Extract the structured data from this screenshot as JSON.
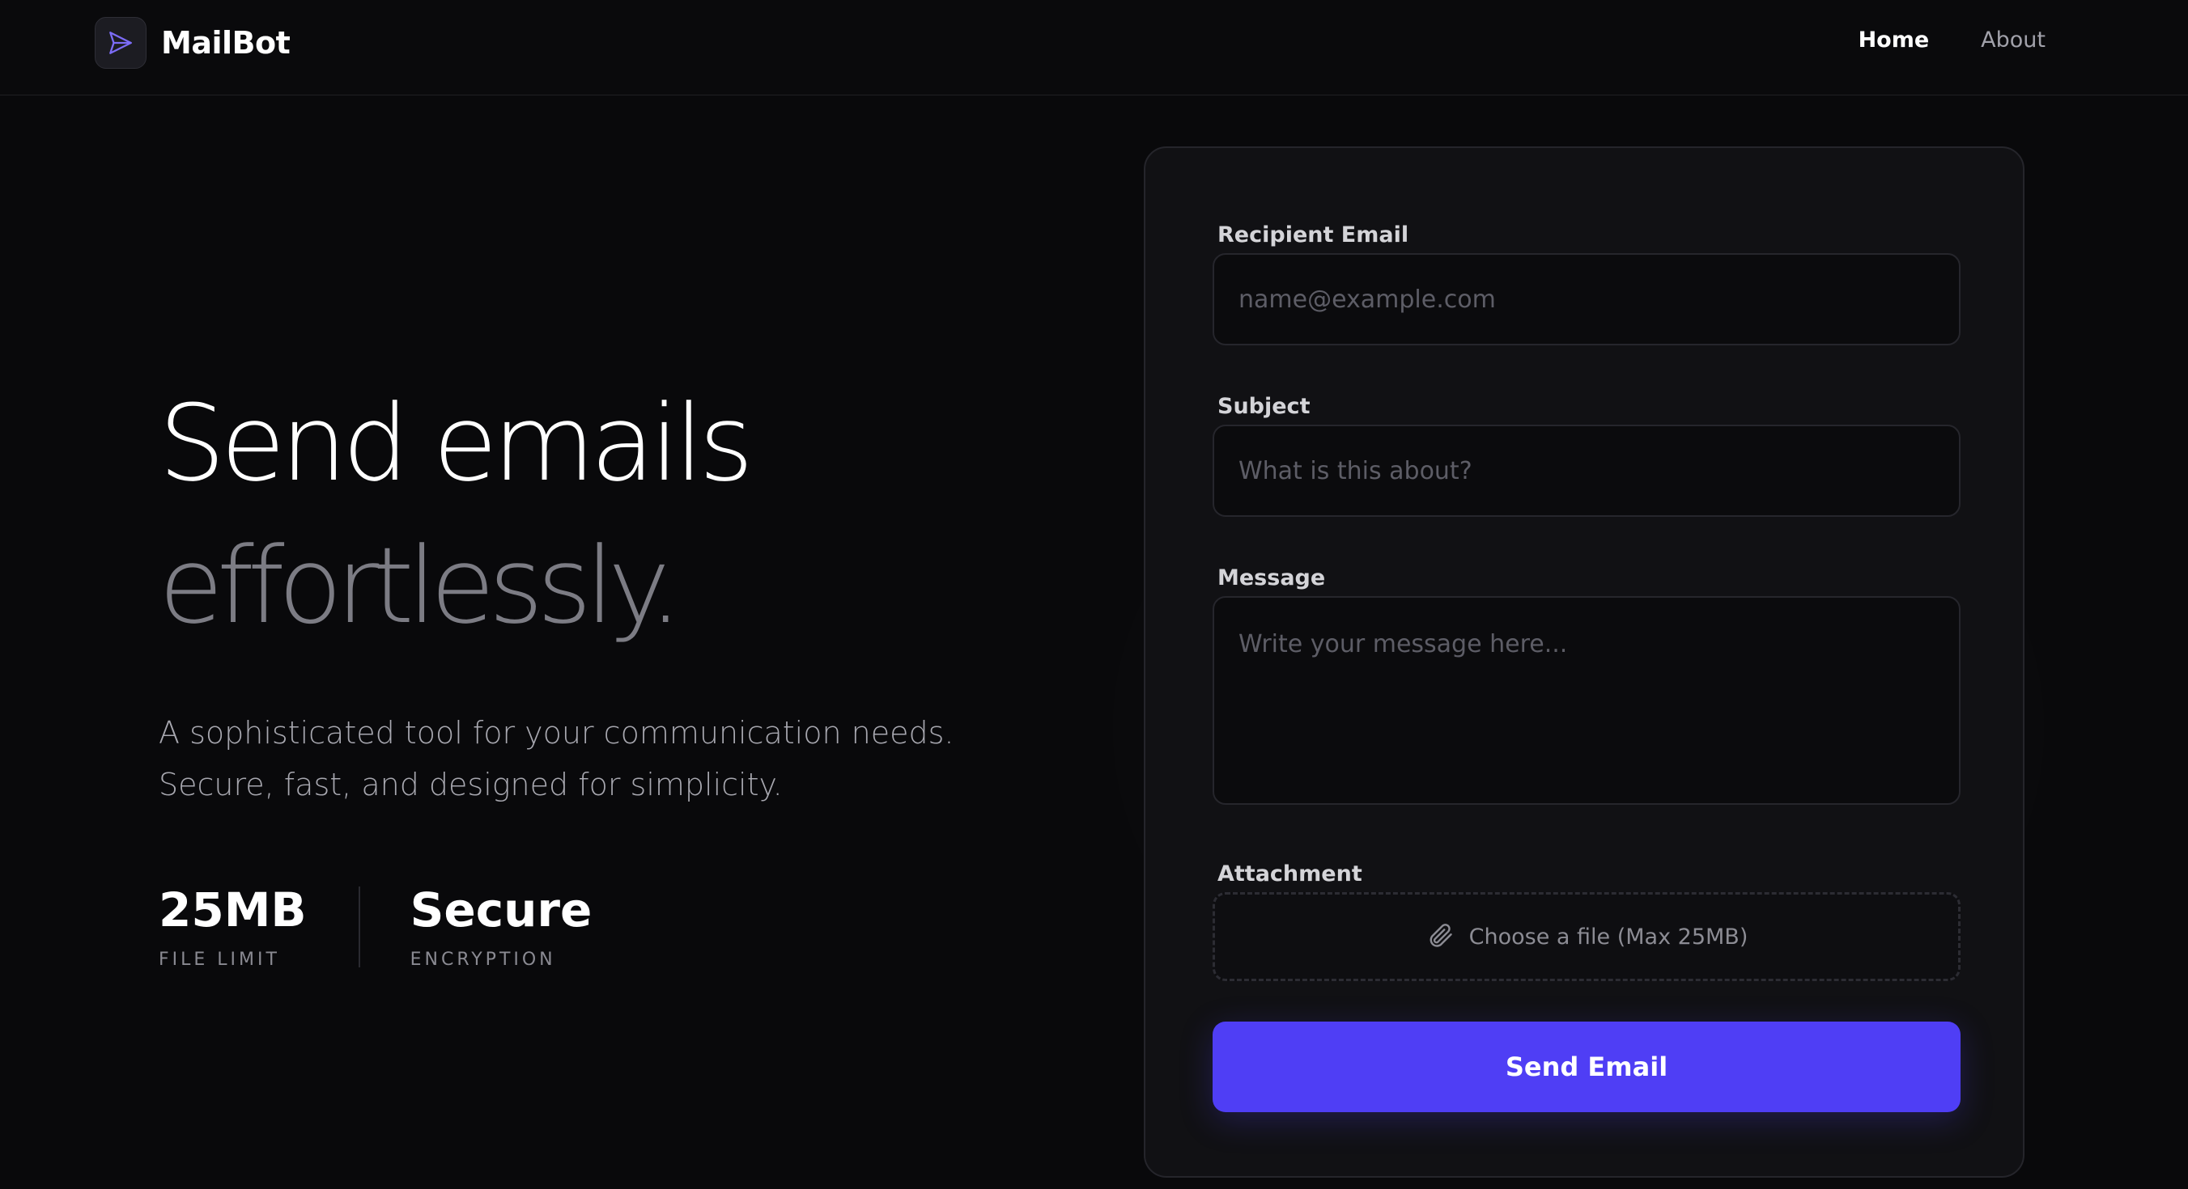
{
  "app": {
    "name": "MailBot",
    "accent": "#4f3ef5"
  },
  "nav": {
    "links": [
      {
        "label": "Home",
        "active": true
      },
      {
        "label": "About",
        "active": false
      }
    ]
  },
  "hero": {
    "line1": "Send emails",
    "line2": "effortlessly.",
    "description_1": "A sophisticated tool for your communication needs.",
    "description_2": "Secure, fast, and designed for simplicity."
  },
  "stats": [
    {
      "value": "25MB",
      "label": "FILE LIMIT"
    },
    {
      "value": "Secure",
      "label": "ENCRYPTION"
    }
  ],
  "form": {
    "recipient": {
      "label": "Recipient Email",
      "placeholder": "name@example.com",
      "value": ""
    },
    "subject": {
      "label": "Subject",
      "placeholder": "What is this about?",
      "value": ""
    },
    "message": {
      "label": "Message",
      "placeholder": "Write your message here...",
      "value": ""
    },
    "attachment": {
      "label": "Attachment",
      "button_text": "Choose a file (Max 25MB)",
      "icon": "paperclip-icon"
    },
    "submit_label": "Send Email"
  }
}
